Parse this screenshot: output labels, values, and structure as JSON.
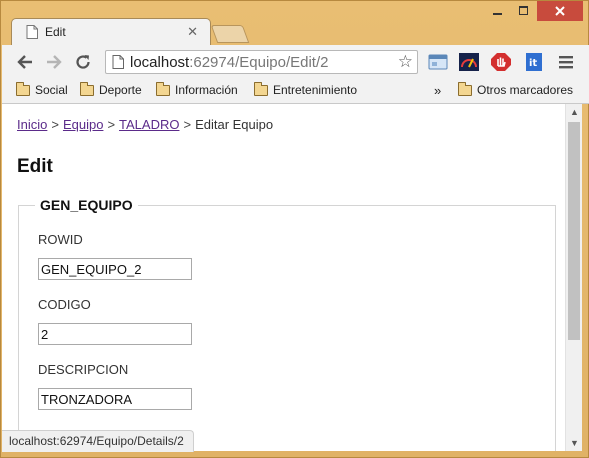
{
  "browser": {
    "tab_title": "Edit",
    "url_host": "localhost",
    "url_rest": ":62974/Equipo/Edit/2"
  },
  "bookmarks": {
    "items": [
      "Social",
      "Deporte",
      "Información",
      "Entretenimiento"
    ],
    "overflow": "»",
    "other": "Otros marcadores"
  },
  "breadcrumb": {
    "home": "Inicio",
    "equipo": "Equipo",
    "item": "TALADRO",
    "current": "Editar Equipo",
    "sep": ">"
  },
  "page": {
    "title": "Edit",
    "legend": "GEN_EQUIPO"
  },
  "form": {
    "rowid_label": "ROWID",
    "rowid_value": "GEN_EQUIPO_2",
    "codigo_label": "CODIGO",
    "codigo_value": "2",
    "descripcion_label": "DESCRIPCION",
    "descripcion_value": "TRONZADORA"
  },
  "status_bar": "localhost:62974/Equipo/Details/2",
  "colors": {
    "frame": "#e4b66c",
    "link": "#5b2b8a",
    "close_button": "#c84b3d"
  }
}
